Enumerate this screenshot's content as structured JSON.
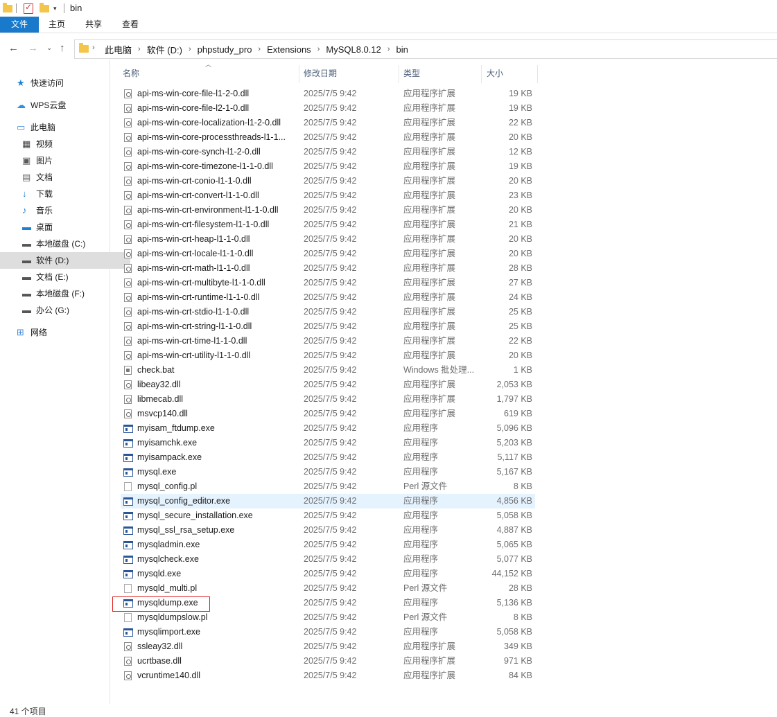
{
  "window": {
    "title": "bin"
  },
  "ribbon": {
    "tabs": [
      "文件",
      "主页",
      "共享",
      "查看"
    ]
  },
  "address": {
    "crumbs": [
      "此电脑",
      "软件 (D:)",
      "phpstudy_pro",
      "Extensions",
      "MySQL8.0.12",
      "bin"
    ]
  },
  "sidebar": {
    "items": [
      {
        "label": "快速访问",
        "icon": "star-icon",
        "color": "#1e7fd6"
      },
      {
        "label": "WPS云盘",
        "icon": "cloud-icon",
        "color": "#2b8fe3"
      },
      {
        "label": "此电脑",
        "icon": "computer-icon",
        "color": "#3d8ad8"
      },
      {
        "label": "视频",
        "icon": "video-icon",
        "color": "#444444"
      },
      {
        "label": "图片",
        "icon": "picture-icon",
        "color": "#5a5a5a"
      },
      {
        "label": "文档",
        "icon": "document-icon",
        "color": "#6b6b6b"
      },
      {
        "label": "下载",
        "icon": "download-icon",
        "color": "#1e7fd6"
      },
      {
        "label": "音乐",
        "icon": "music-icon",
        "color": "#1e7fd6"
      },
      {
        "label": "桌面",
        "icon": "desktop-icon",
        "color": "#1e7fd6"
      },
      {
        "label": "本地磁盘 (C:)",
        "icon": "drive-c-icon",
        "color": "#555555"
      },
      {
        "label": "软件 (D:)",
        "icon": "drive-icon",
        "color": "#555555"
      },
      {
        "label": "文档 (E:)",
        "icon": "drive-icon",
        "color": "#555555"
      },
      {
        "label": "本地磁盘 (F:)",
        "icon": "drive-icon",
        "color": "#555555"
      },
      {
        "label": "办公 (G:)",
        "icon": "drive-icon",
        "color": "#555555"
      },
      {
        "label": "网络",
        "icon": "network-icon",
        "color": "#3d8ad8"
      }
    ]
  },
  "columns": {
    "name": "名称",
    "date": "修改日期",
    "type": "类型",
    "size": "大小"
  },
  "files": [
    {
      "name": "api-ms-win-core-file-l1-2-0.dll",
      "date": "2025/7/5 9:42",
      "type": "应用程序扩展",
      "size": "19 KB",
      "kind": "dll"
    },
    {
      "name": "api-ms-win-core-file-l2-1-0.dll",
      "date": "2025/7/5 9:42",
      "type": "应用程序扩展",
      "size": "19 KB",
      "kind": "dll"
    },
    {
      "name": "api-ms-win-core-localization-l1-2-0.dll",
      "date": "2025/7/5 9:42",
      "type": "应用程序扩展",
      "size": "22 KB",
      "kind": "dll"
    },
    {
      "name": "api-ms-win-core-processthreads-l1-1...",
      "date": "2025/7/5 9:42",
      "type": "应用程序扩展",
      "size": "20 KB",
      "kind": "dll"
    },
    {
      "name": "api-ms-win-core-synch-l1-2-0.dll",
      "date": "2025/7/5 9:42",
      "type": "应用程序扩展",
      "size": "12 KB",
      "kind": "dll"
    },
    {
      "name": "api-ms-win-core-timezone-l1-1-0.dll",
      "date": "2025/7/5 9:42",
      "type": "应用程序扩展",
      "size": "19 KB",
      "kind": "dll"
    },
    {
      "name": "api-ms-win-crt-conio-l1-1-0.dll",
      "date": "2025/7/5 9:42",
      "type": "应用程序扩展",
      "size": "20 KB",
      "kind": "dll"
    },
    {
      "name": "api-ms-win-crt-convert-l1-1-0.dll",
      "date": "2025/7/5 9:42",
      "type": "应用程序扩展",
      "size": "23 KB",
      "kind": "dll"
    },
    {
      "name": "api-ms-win-crt-environment-l1-1-0.dll",
      "date": "2025/7/5 9:42",
      "type": "应用程序扩展",
      "size": "20 KB",
      "kind": "dll"
    },
    {
      "name": "api-ms-win-crt-filesystem-l1-1-0.dll",
      "date": "2025/7/5 9:42",
      "type": "应用程序扩展",
      "size": "21 KB",
      "kind": "dll"
    },
    {
      "name": "api-ms-win-crt-heap-l1-1-0.dll",
      "date": "2025/7/5 9:42",
      "type": "应用程序扩展",
      "size": "20 KB",
      "kind": "dll"
    },
    {
      "name": "api-ms-win-crt-locale-l1-1-0.dll",
      "date": "2025/7/5 9:42",
      "type": "应用程序扩展",
      "size": "20 KB",
      "kind": "dll"
    },
    {
      "name": "api-ms-win-crt-math-l1-1-0.dll",
      "date": "2025/7/5 9:42",
      "type": "应用程序扩展",
      "size": "28 KB",
      "kind": "dll"
    },
    {
      "name": "api-ms-win-crt-multibyte-l1-1-0.dll",
      "date": "2025/7/5 9:42",
      "type": "应用程序扩展",
      "size": "27 KB",
      "kind": "dll"
    },
    {
      "name": "api-ms-win-crt-runtime-l1-1-0.dll",
      "date": "2025/7/5 9:42",
      "type": "应用程序扩展",
      "size": "24 KB",
      "kind": "dll"
    },
    {
      "name": "api-ms-win-crt-stdio-l1-1-0.dll",
      "date": "2025/7/5 9:42",
      "type": "应用程序扩展",
      "size": "25 KB",
      "kind": "dll"
    },
    {
      "name": "api-ms-win-crt-string-l1-1-0.dll",
      "date": "2025/7/5 9:42",
      "type": "应用程序扩展",
      "size": "25 KB",
      "kind": "dll"
    },
    {
      "name": "api-ms-win-crt-time-l1-1-0.dll",
      "date": "2025/7/5 9:42",
      "type": "应用程序扩展",
      "size": "22 KB",
      "kind": "dll"
    },
    {
      "name": "api-ms-win-crt-utility-l1-1-0.dll",
      "date": "2025/7/5 9:42",
      "type": "应用程序扩展",
      "size": "20 KB",
      "kind": "dll"
    },
    {
      "name": "check.bat",
      "date": "2025/7/5 9:42",
      "type": "Windows 批处理...",
      "size": "1 KB",
      "kind": "bat"
    },
    {
      "name": "libeay32.dll",
      "date": "2025/7/5 9:42",
      "type": "应用程序扩展",
      "size": "2,053 KB",
      "kind": "dll"
    },
    {
      "name": "libmecab.dll",
      "date": "2025/7/5 9:42",
      "type": "应用程序扩展",
      "size": "1,797 KB",
      "kind": "dll"
    },
    {
      "name": "msvcp140.dll",
      "date": "2025/7/5 9:42",
      "type": "应用程序扩展",
      "size": "619 KB",
      "kind": "dll"
    },
    {
      "name": "myisam_ftdump.exe",
      "date": "2025/7/5 9:42",
      "type": "应用程序",
      "size": "5,096 KB",
      "kind": "exe"
    },
    {
      "name": "myisamchk.exe",
      "date": "2025/7/5 9:42",
      "type": "应用程序",
      "size": "5,203 KB",
      "kind": "exe"
    },
    {
      "name": "myisampack.exe",
      "date": "2025/7/5 9:42",
      "type": "应用程序",
      "size": "5,117 KB",
      "kind": "exe"
    },
    {
      "name": "mysql.exe",
      "date": "2025/7/5 9:42",
      "type": "应用程序",
      "size": "5,167 KB",
      "kind": "exe"
    },
    {
      "name": "mysql_config.pl",
      "date": "2025/7/5 9:42",
      "type": "Perl 源文件",
      "size": "8 KB",
      "kind": "pl"
    },
    {
      "name": "mysql_config_editor.exe",
      "date": "2025/7/5 9:42",
      "type": "应用程序",
      "size": "4,856 KB",
      "kind": "exe"
    },
    {
      "name": "mysql_secure_installation.exe",
      "date": "2025/7/5 9:42",
      "type": "应用程序",
      "size": "5,058 KB",
      "kind": "exe"
    },
    {
      "name": "mysql_ssl_rsa_setup.exe",
      "date": "2025/7/5 9:42",
      "type": "应用程序",
      "size": "4,887 KB",
      "kind": "exe"
    },
    {
      "name": "mysqladmin.exe",
      "date": "2025/7/5 9:42",
      "type": "应用程序",
      "size": "5,065 KB",
      "kind": "exe"
    },
    {
      "name": "mysqlcheck.exe",
      "date": "2025/7/5 9:42",
      "type": "应用程序",
      "size": "5,077 KB",
      "kind": "exe"
    },
    {
      "name": "mysqld.exe",
      "date": "2025/7/5 9:42",
      "type": "应用程序",
      "size": "44,152 KB",
      "kind": "exe"
    },
    {
      "name": "mysqld_multi.pl",
      "date": "2025/7/5 9:42",
      "type": "Perl 源文件",
      "size": "28 KB",
      "kind": "pl"
    },
    {
      "name": "mysqldump.exe",
      "date": "2025/7/5 9:42",
      "type": "应用程序",
      "size": "5,136 KB",
      "kind": "exe"
    },
    {
      "name": "mysqldumpslow.pl",
      "date": "2025/7/5 9:42",
      "type": "Perl 源文件",
      "size": "8 KB",
      "kind": "pl"
    },
    {
      "name": "mysqlimport.exe",
      "date": "2025/7/5 9:42",
      "type": "应用程序",
      "size": "5,058 KB",
      "kind": "exe"
    },
    {
      "name": "ssleay32.dll",
      "date": "2025/7/5 9:42",
      "type": "应用程序扩展",
      "size": "349 KB",
      "kind": "dll"
    },
    {
      "name": "ucrtbase.dll",
      "date": "2025/7/5 9:42",
      "type": "应用程序扩展",
      "size": "971 KB",
      "kind": "dll"
    },
    {
      "name": "vcruntime140.dll",
      "date": "2025/7/5 9:42",
      "type": "应用程序扩展",
      "size": "84 KB",
      "kind": "dll"
    }
  ],
  "status": {
    "item_count": "41 个项目"
  },
  "colors": {
    "accent": "#1979ca",
    "highlight": "#e5f3ff",
    "annotation": "#e02020"
  }
}
